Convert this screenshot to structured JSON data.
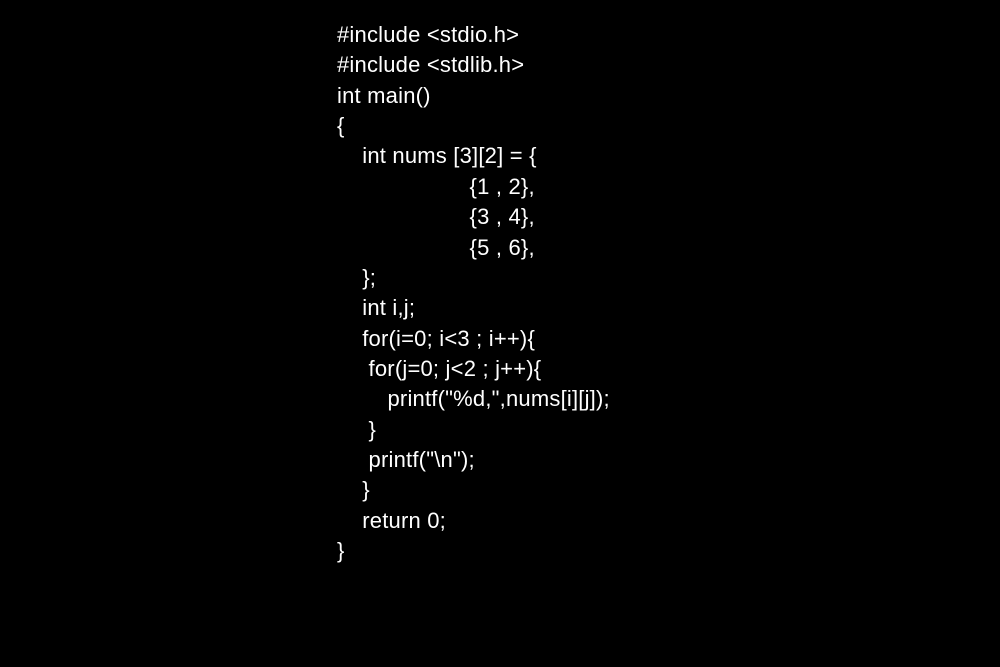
{
  "code": {
    "lines": [
      "#include <stdio.h>",
      "#include <stdlib.h>",
      "",
      "int main()",
      "{",
      "    int nums [3][2] = {",
      "                     {1 , 2},",
      "                     {3 , 4},",
      "                     {5 , 6},",
      "    };",
      "    int i,j;",
      "    for(i=0; i<3 ; i++){",
      "     for(j=0; j<2 ; j++){",
      "        printf(\"%d,\",nums[i][j]);",
      "     }",
      "     printf(\"\\n\");",
      "    }",
      "",
      "    return 0;",
      "}"
    ]
  }
}
